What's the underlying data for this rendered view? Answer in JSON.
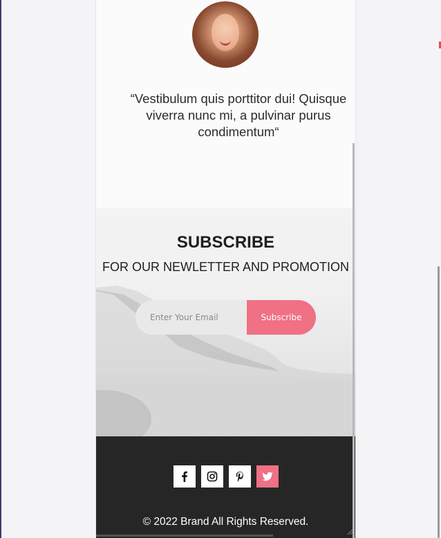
{
  "testimonial": {
    "quote": "“Vestibulum quis porttitor dui! Quisque viverra nunc mi, a pulvinar purus condimentum“"
  },
  "subscribe": {
    "title": "SUBSCRIBE",
    "subtitle": "FOR OUR NEWLETTER AND PROMOTION",
    "email_placeholder": "Enter Your Email",
    "button_label": "Subscribe"
  },
  "footer": {
    "social": [
      {
        "name": "facebook-icon"
      },
      {
        "name": "instagram-icon"
      },
      {
        "name": "pinterest-icon"
      },
      {
        "name": "twitter-icon"
      }
    ],
    "copyright": "© 2022 Brand All Rights Reserved."
  },
  "colors": {
    "accent": "#f07084",
    "footer_bg": "#262626",
    "text": "#1e1e1e"
  }
}
